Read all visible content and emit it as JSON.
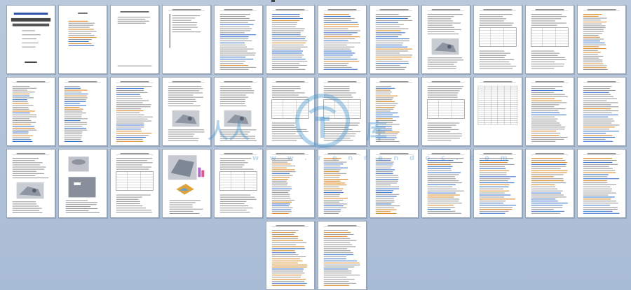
{
  "viewer": {
    "page_count": 38
  },
  "watermark": {
    "left_text": "人人",
    "right_text": "库",
    "url_text": "w w w . r e n r e n d o c . c o m",
    "color": "#4896cd"
  },
  "colors": {
    "background": "#b0c2d9",
    "page": "#ffffff",
    "page_border": "#9aa6b5",
    "text_line": "#9a9a9a",
    "heading_blue": "#2a4fa8",
    "table_line": "#555555"
  },
  "pages": [
    {
      "kind": "cover"
    },
    {
      "kind": "toc"
    },
    {
      "kind": "abstract"
    },
    {
      "kind": "abstract2"
    },
    {
      "kind": "text"
    },
    {
      "kind": "text"
    },
    {
      "kind": "text"
    },
    {
      "kind": "text"
    },
    {
      "kind": "figure_text"
    },
    {
      "kind": "table_text"
    },
    {
      "kind": "table_text"
    },
    {
      "kind": "list"
    },
    {
      "kind": "list"
    },
    {
      "kind": "list"
    },
    {
      "kind": "text"
    },
    {
      "kind": "figure_text"
    },
    {
      "kind": "figure_text"
    },
    {
      "kind": "table_text"
    },
    {
      "kind": "table_text"
    },
    {
      "kind": "list"
    },
    {
      "kind": "table_text"
    },
    {
      "kind": "form"
    },
    {
      "kind": "text"
    },
    {
      "kind": "text"
    },
    {
      "kind": "figure_text"
    },
    {
      "kind": "photos"
    },
    {
      "kind": "table_text"
    },
    {
      "kind": "figure_cad"
    },
    {
      "kind": "table_text"
    },
    {
      "kind": "list"
    },
    {
      "kind": "list"
    },
    {
      "kind": "list"
    },
    {
      "kind": "text"
    },
    {
      "kind": "text"
    },
    {
      "kind": "text"
    },
    {
      "kind": "text"
    },
    {
      "kind": "text"
    },
    {
      "kind": "text"
    }
  ]
}
